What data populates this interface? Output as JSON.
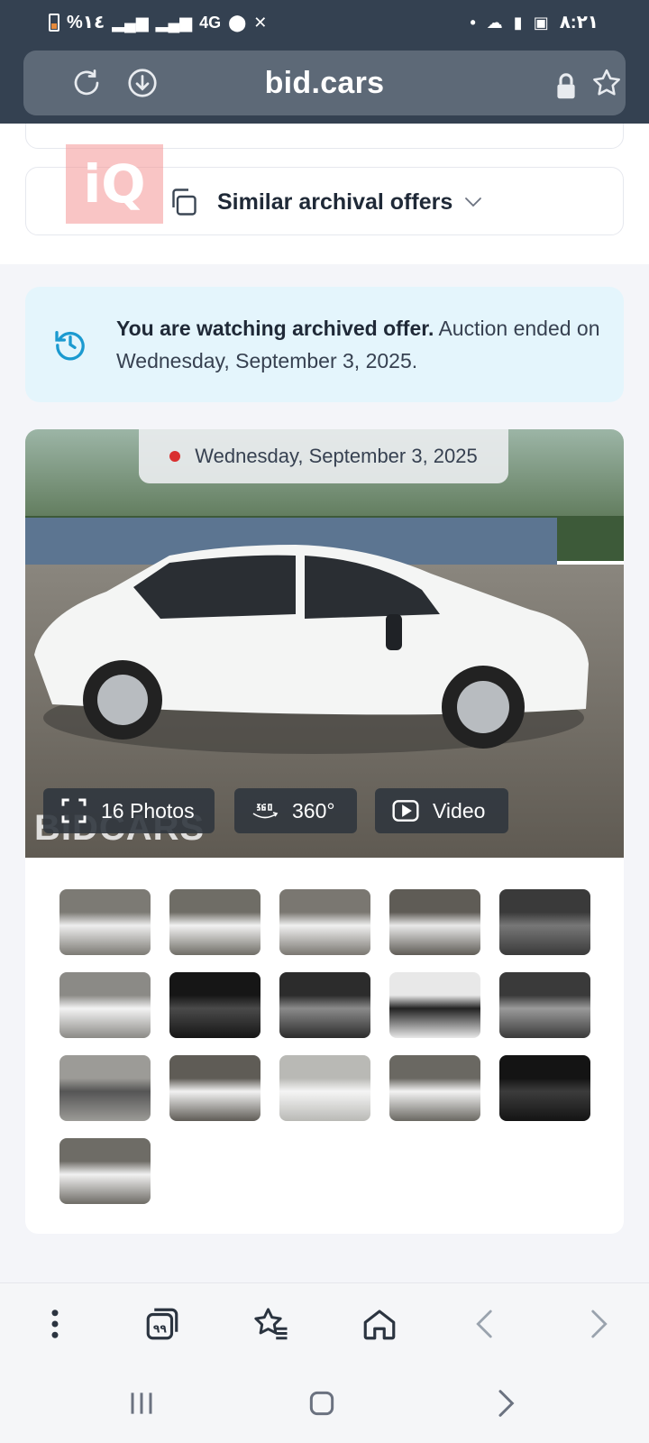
{
  "status_bar": {
    "battery_percent": "%١٤",
    "network_type": "4G",
    "time": "٨:٢١"
  },
  "browser": {
    "url": "bid.cars"
  },
  "page": {
    "similar_offers_label": "Similar archival offers",
    "notice": {
      "bold_text": "You are watching archived offer.",
      "rest_text": " Auction ended on Wednesday, September 3, 2025."
    },
    "gallery": {
      "date_chip": "Wednesday, September 3, 2025",
      "photos_label": "16 Photos",
      "threesixty_label": "360°",
      "video_label": "Video",
      "thumbnail_count": 16
    }
  },
  "colors": {
    "chrome": "#344151",
    "url_bar": "#5d6977",
    "notice_bg": "#e4f5fc",
    "accent_blue": "#1b9ad0",
    "live_dot": "#d92f2f"
  },
  "icons": [
    "reload-icon",
    "download-icon",
    "lock-icon",
    "star-icon",
    "copy-icon",
    "chevron-down-icon",
    "history-icon",
    "expand-icon",
    "360-icon",
    "play-icon",
    "menu-icon",
    "tabs-icon",
    "bookmarks-icon",
    "home-icon",
    "back-icon",
    "forward-icon"
  ]
}
